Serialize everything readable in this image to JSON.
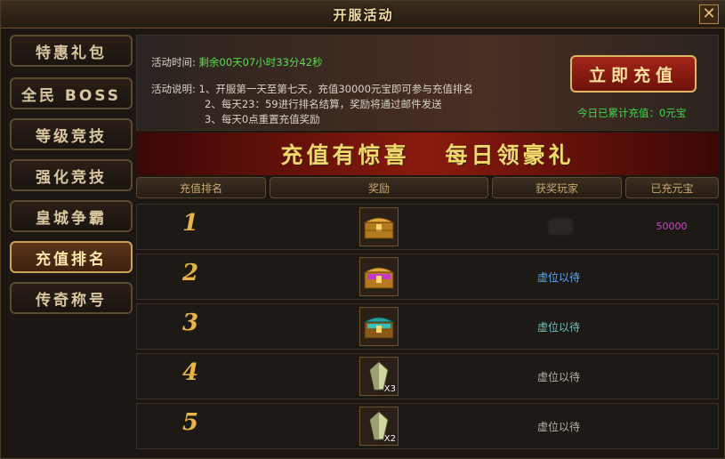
{
  "window": {
    "title": "开服活动",
    "close_label": "✕"
  },
  "sidebar": {
    "items": [
      {
        "label": "特惠礼包",
        "active": false
      },
      {
        "label": "全民 BOSS",
        "active": false
      },
      {
        "label": "等级竞技",
        "active": false
      },
      {
        "label": "强化竞技",
        "active": false
      },
      {
        "label": "皇城争霸",
        "active": false
      },
      {
        "label": "充值排名",
        "active": true
      },
      {
        "label": "传奇称号",
        "active": false
      }
    ]
  },
  "info": {
    "time_label": "活动时间:",
    "time_value": "剩余00天07小时33分42秒",
    "desc_label": "活动说明:",
    "desc_lines": [
      "1、开服第一天至第七天，充值30000元宝即可参与充值排名",
      "2、每天23：59进行排名结算，奖励将通过邮件发送",
      "3、每天0点重置充值奖励"
    ],
    "recharge_button": "立即充值",
    "today_total": "今日已累计充值：0元宝"
  },
  "banner": {
    "left": "充值有惊喜",
    "right": "每日领豪礼"
  },
  "table": {
    "headers": [
      "充值排名",
      "奖励",
      "获奖玩家",
      "已充元宝"
    ],
    "rows": [
      {
        "rank": "1",
        "reward": "gold-chest-icon",
        "qty": "",
        "player": "",
        "amount": "50000"
      },
      {
        "rank": "2",
        "reward": "purple-chest-icon",
        "qty": "",
        "player": "虚位以待",
        "amount": ""
      },
      {
        "rank": "3",
        "reward": "teal-chest-icon",
        "qty": "",
        "player": "虚位以待",
        "amount": ""
      },
      {
        "rank": "4",
        "reward": "crystal-icon",
        "qty": "X3",
        "player": "虚位以待",
        "amount": ""
      },
      {
        "rank": "5",
        "reward": "crystal-icon",
        "qty": "X2",
        "player": "虚位以待",
        "amount": ""
      }
    ]
  },
  "colors": {
    "accent_gold": "#e5b346",
    "banner_red": "#8a1a0d",
    "time_green": "#57e04d",
    "player_blue": "#5aa6ff"
  }
}
